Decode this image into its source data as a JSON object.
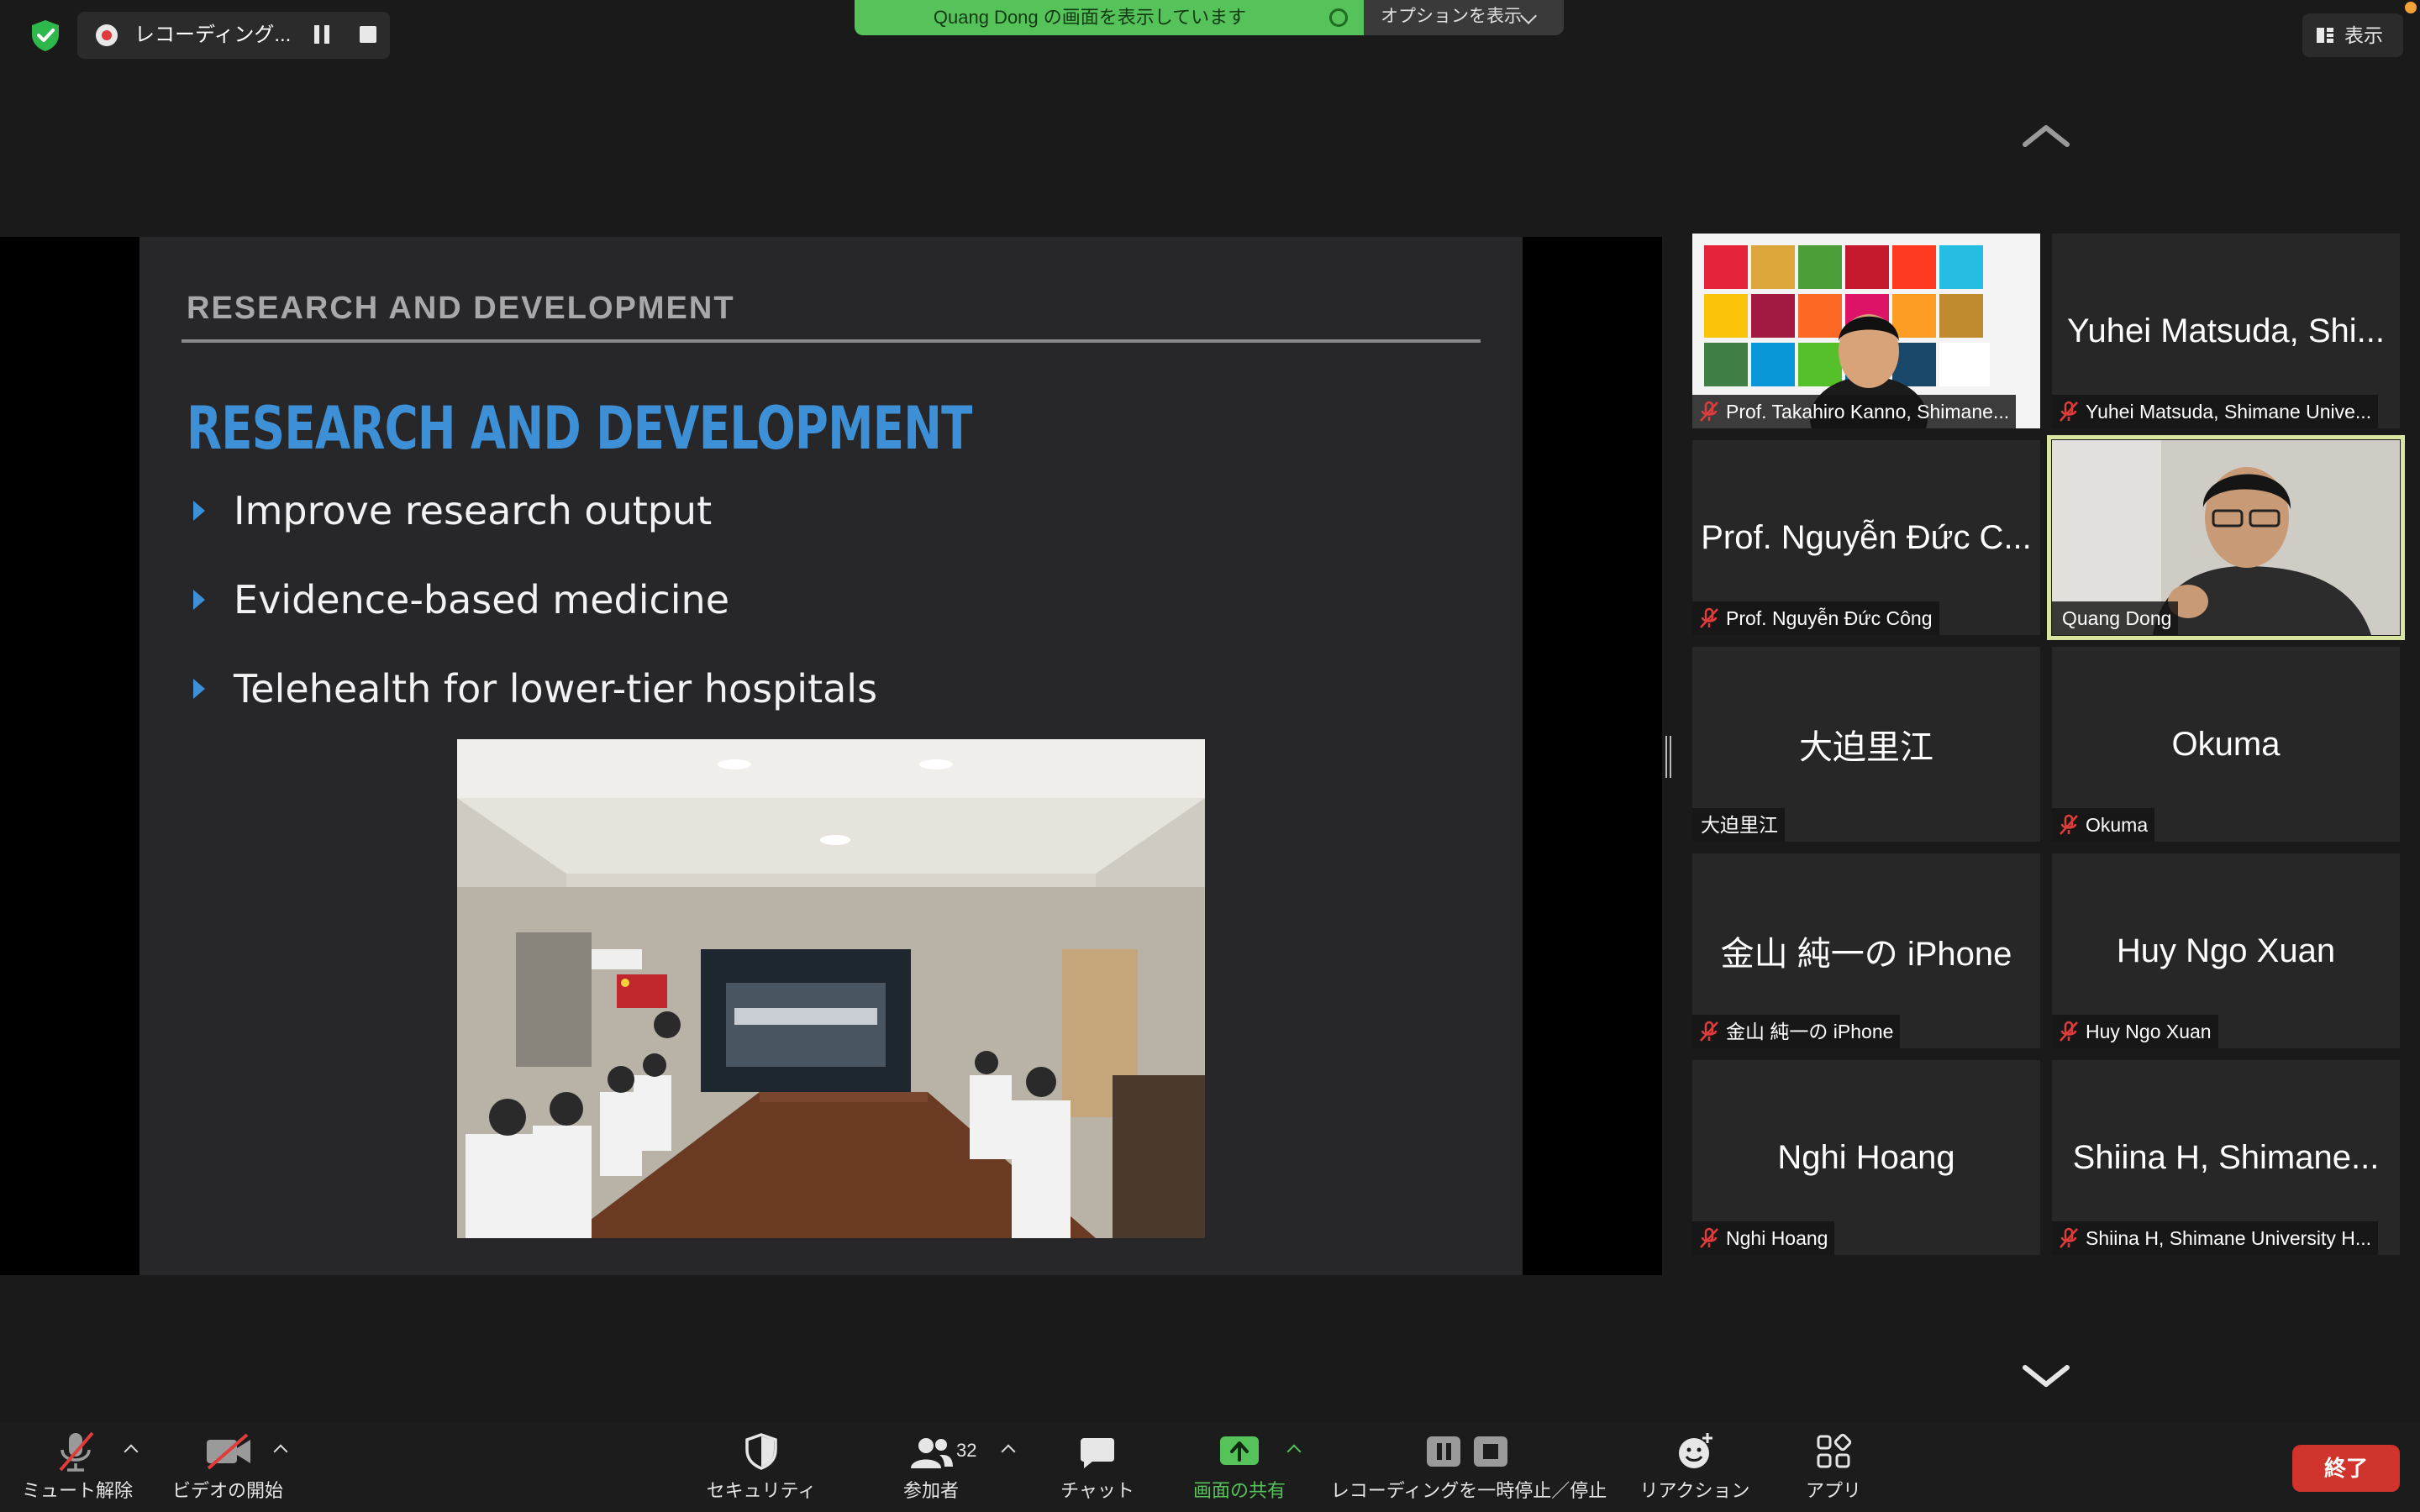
{
  "top_bar": {
    "recording_label": "レコーディング...",
    "share_banner_text": "Quang Dong の画面を表示しています",
    "options_label": "オプションを表示",
    "view_label": "表示"
  },
  "slide": {
    "header": "RESEARCH AND DEVELOPMENT",
    "title": "RESEARCH AND DEVELOPMENT",
    "bullets": [
      "Improve research output",
      "Evidence-based medicine",
      "Telehealth for lower-tier hospitals"
    ],
    "accent_color": "#3d8fd6"
  },
  "participants": [
    {
      "center": "",
      "name": "Prof. Takahiro Kanno, Shimane...",
      "muted": true
    },
    {
      "center": "Yuhei Matsuda, Shi...",
      "name": "Yuhei Matsuda, Shimane Unive...",
      "muted": true
    },
    {
      "center": "Prof. Nguyễn Đức C...",
      "name": "Prof. Nguyễn Đức Công",
      "muted": true
    },
    {
      "center": "",
      "name": "Quang Dong",
      "muted": false,
      "active_speaker": true
    },
    {
      "center": "大迫里江",
      "name": "大迫里江",
      "muted": false
    },
    {
      "center": "Okuma",
      "name": "Okuma",
      "muted": true
    },
    {
      "center": "金山 純一の iPhone",
      "name": "金山 純一の iPhone",
      "muted": true
    },
    {
      "center": "Huy Ngo Xuan",
      "name": "Huy Ngo Xuan",
      "muted": true
    },
    {
      "center": "Nghi Hoang",
      "name": "Nghi Hoang",
      "muted": true
    },
    {
      "center": "Shiina H, Shimane...",
      "name": "Shiina H, Shimane University H...",
      "muted": true
    }
  ],
  "toolbar": {
    "unmute_label": "ミュート解除",
    "video_label": "ビデオの開始",
    "security_label": "セキュリティ",
    "participants_label": "参加者",
    "participants_count": "32",
    "chat_label": "チャット",
    "share_label": "画面の共有",
    "recording_label": "レコーディングを一時停止／停止",
    "reactions_label": "リアクション",
    "apps_label": "アプリ",
    "end_label": "終了",
    "share_color": "#56c25a",
    "end_color": "#d0342c"
  },
  "icons": {
    "shield": "shield-check-icon",
    "mic": "mic-muted-icon",
    "video": "video-off-icon",
    "security": "shield-icon",
    "participants": "people-icon",
    "chat": "chat-bubble-icon",
    "share": "share-screen-icon",
    "recording": "pause-stop-icon",
    "reactions": "emoji-plus-icon",
    "apps": "apps-icon"
  }
}
